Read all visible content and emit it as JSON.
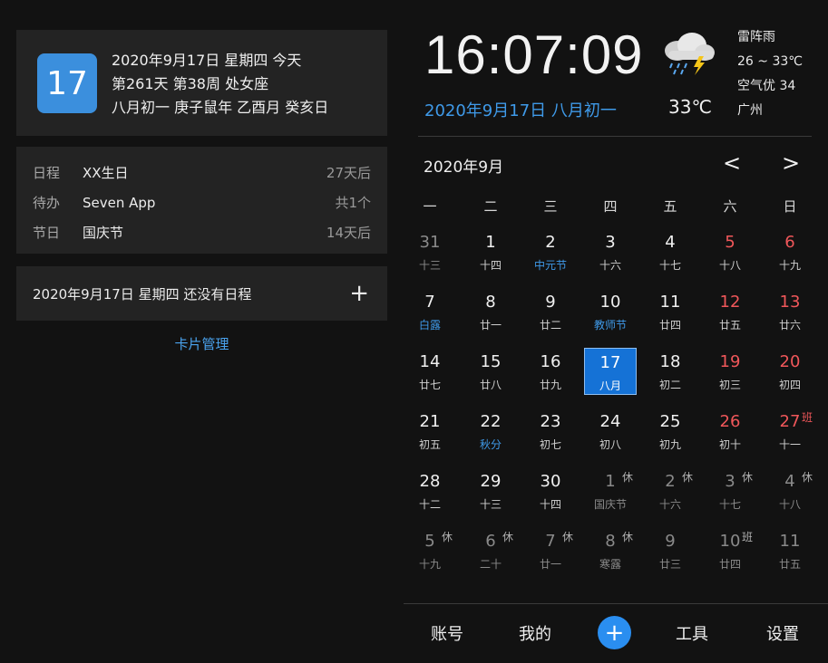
{
  "today_card": {
    "day": "17",
    "line1": "2020年9月17日 星期四 今天",
    "line2": "第261天 第38周 处女座",
    "line3": "八月初一 庚子鼠年 乙酉月 癸亥日"
  },
  "summary": [
    {
      "label": "日程",
      "value": "XX生日",
      "right": "27天后"
    },
    {
      "label": "待办",
      "value": "Seven App",
      "right": "共1个"
    },
    {
      "label": "节日",
      "value": "国庆节",
      "right": "14天后"
    }
  ],
  "schedule": {
    "text": "2020年9月17日 星期四 还没有日程",
    "add_icon": "+"
  },
  "card_manage": "卡片管理",
  "clock": {
    "time": "16:07:09",
    "date": "2020年9月17日 八月初一"
  },
  "weather": {
    "icon": "thunderstorm-icon",
    "temp_now": "33℃",
    "condition": "雷阵雨",
    "range": "26 ~ 33℃",
    "air": "空气优 34",
    "city": "广州"
  },
  "calendar": {
    "title": "2020年9月",
    "prev": "<",
    "next": ">",
    "weekdays": [
      "一",
      "二",
      "三",
      "四",
      "五",
      "六",
      "日"
    ],
    "days": [
      {
        "n": "31",
        "s": "十三",
        "other": true
      },
      {
        "n": "1",
        "s": "十四"
      },
      {
        "n": "2",
        "s": "中元节",
        "holiday": true
      },
      {
        "n": "3",
        "s": "十六"
      },
      {
        "n": "4",
        "s": "十七"
      },
      {
        "n": "5",
        "s": "十八",
        "weekend": true
      },
      {
        "n": "6",
        "s": "十九",
        "weekend": true
      },
      {
        "n": "7",
        "s": "白露",
        "holiday": true
      },
      {
        "n": "8",
        "s": "廿一"
      },
      {
        "n": "9",
        "s": "廿二"
      },
      {
        "n": "10",
        "s": "教师节",
        "holiday": true
      },
      {
        "n": "11",
        "s": "廿四"
      },
      {
        "n": "12",
        "s": "廿五",
        "weekend": true
      },
      {
        "n": "13",
        "s": "廿六",
        "weekend": true
      },
      {
        "n": "14",
        "s": "廿七"
      },
      {
        "n": "15",
        "s": "廿八"
      },
      {
        "n": "16",
        "s": "廿九"
      },
      {
        "n": "17",
        "s": "八月",
        "selected": true
      },
      {
        "n": "18",
        "s": "初二"
      },
      {
        "n": "19",
        "s": "初三",
        "weekend": true
      },
      {
        "n": "20",
        "s": "初四",
        "weekend": true
      },
      {
        "n": "21",
        "s": "初五"
      },
      {
        "n": "22",
        "s": "秋分",
        "holiday": true
      },
      {
        "n": "23",
        "s": "初七"
      },
      {
        "n": "24",
        "s": "初八"
      },
      {
        "n": "25",
        "s": "初九"
      },
      {
        "n": "26",
        "s": "初十",
        "weekend": true
      },
      {
        "n": "27",
        "s": "十一",
        "weekend": true,
        "tag": "班",
        "workday": true
      },
      {
        "n": "28",
        "s": "十二"
      },
      {
        "n": "29",
        "s": "十三"
      },
      {
        "n": "30",
        "s": "十四"
      },
      {
        "n": "1",
        "s": "国庆节",
        "other": true,
        "tag": "休"
      },
      {
        "n": "2",
        "s": "十六",
        "other": true,
        "tag": "休"
      },
      {
        "n": "3",
        "s": "十七",
        "other": true,
        "tag": "休"
      },
      {
        "n": "4",
        "s": "十八",
        "other": true,
        "tag": "休"
      },
      {
        "n": "5",
        "s": "十九",
        "other": true,
        "tag": "休"
      },
      {
        "n": "6",
        "s": "二十",
        "other": true,
        "tag": "休"
      },
      {
        "n": "7",
        "s": "廿一",
        "other": true,
        "tag": "休"
      },
      {
        "n": "8",
        "s": "寒露",
        "other": true,
        "tag": "休"
      },
      {
        "n": "9",
        "s": "廿三",
        "other": true
      },
      {
        "n": "10",
        "s": "廿四",
        "other": true,
        "tag": "班",
        "workday": true
      },
      {
        "n": "11",
        "s": "廿五",
        "other": true
      }
    ]
  },
  "bottom_nav": {
    "account": "账号",
    "mine": "我的",
    "add": "+",
    "tools": "工具",
    "settings": "设置"
  }
}
